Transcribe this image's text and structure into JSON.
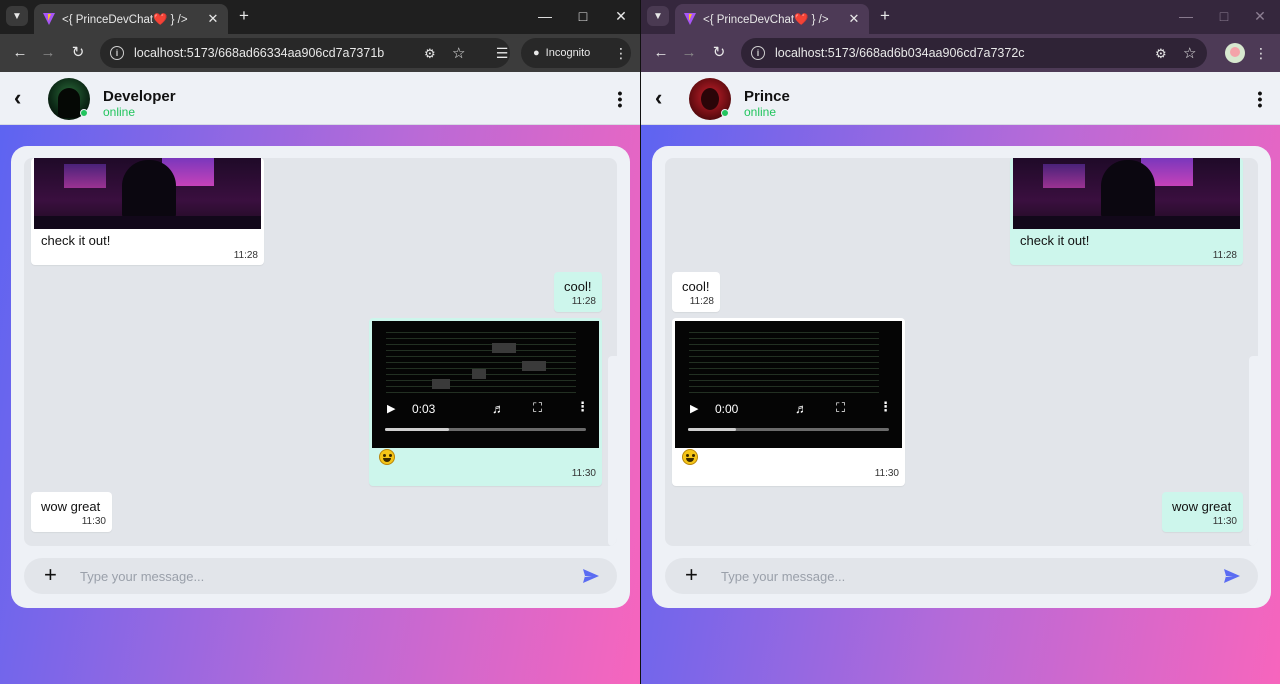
{
  "windows": [
    {
      "tab": {
        "title": "<{ PrinceDevChat❤️ } />",
        "close": "✕"
      },
      "url": "localhost:5173/668ad66334aa906cd7a7371b",
      "incognito_label": "Incognito",
      "contact": {
        "name": "Developer",
        "status": "online"
      },
      "messages": {
        "m1": {
          "text": "check it out!",
          "time": "11:28"
        },
        "m2": {
          "text": "cool!",
          "time": "11:28"
        },
        "m3": {
          "time": "11:30",
          "video_time": "0:03",
          "progress": 0.32
        },
        "m4": {
          "text": "wow great",
          "time": "11:30"
        }
      },
      "input_placeholder": "Type your message..."
    },
    {
      "tab": {
        "title": "<{ PrinceDevChat❤️ } />",
        "close": "✕"
      },
      "url": "localhost:5173/668ad6b034aa906cd7a7372c",
      "contact": {
        "name": "Prince",
        "status": "online"
      },
      "messages": {
        "m1": {
          "text": "check it out!",
          "time": "11:28"
        },
        "m2": {
          "text": "cool!",
          "time": "11:28"
        },
        "m3": {
          "time": "11:30",
          "video_time": "0:00",
          "progress": 0.24
        },
        "m4": {
          "text": "wow great",
          "time": "11:30"
        }
      },
      "input_placeholder": "Type your message..."
    }
  ],
  "colors": {
    "online": "#22c55e",
    "outgoing_bubble": "#cdf6ec",
    "incoming_bubble": "#ffffff",
    "send": "#5b6cf2",
    "gradient_start": "#5b64f2",
    "gradient_end": "#f765bd"
  },
  "icons": {
    "tab_search": "chevron-down-icon",
    "favicon": "vite-logo-icon",
    "close": "close-icon",
    "new_tab": "plus-icon",
    "minimize": "minimize-icon",
    "maximize": "maximize-icon",
    "window_close": "close-icon",
    "back": "arrow-left-icon",
    "forward": "arrow-right-icon",
    "reload": "reload-icon",
    "site_info": "info-icon",
    "password": "key-icon",
    "bookmark": "star-icon",
    "media": "media-controls-icon",
    "incognito": "incognito-icon",
    "menu": "kebab-icon",
    "chat_back": "chevron-left-icon",
    "chat_menu": "kebab-icon",
    "attach": "plus-icon",
    "send": "send-icon",
    "play": "play-icon",
    "volume": "volume-icon",
    "fullscreen": "fullscreen-icon",
    "video_more": "kebab-icon",
    "emoji": "smiley-emoji-icon"
  }
}
